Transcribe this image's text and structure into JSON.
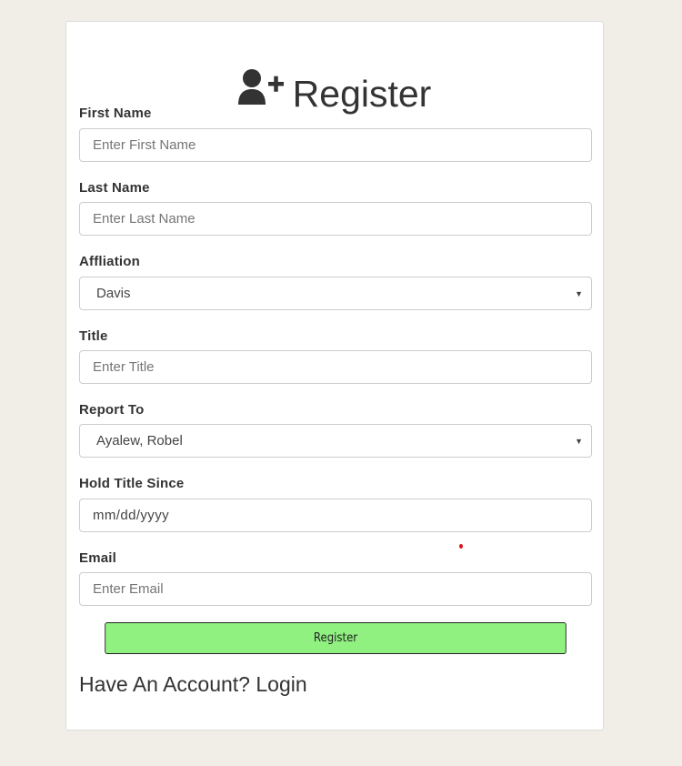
{
  "form": {
    "title": "Register",
    "icon": "user-plus-icon",
    "fields": {
      "first_name": {
        "label": "First Name",
        "placeholder": "Enter First Name"
      },
      "last_name": {
        "label": "Last Name",
        "placeholder": "Enter Last Name"
      },
      "affiliation": {
        "label": "Affliation",
        "value": "Davis"
      },
      "title": {
        "label": "Title",
        "placeholder": "Enter Title"
      },
      "report_to": {
        "label": "Report To",
        "value": "Ayalew, Robel"
      },
      "hold_title_since": {
        "label": "Hold Title Since",
        "value": "mm/dd/yyyy"
      },
      "email": {
        "label": "Email",
        "placeholder": "Enter Email"
      }
    },
    "submit_label": "Register",
    "footer": {
      "prompt": "Have An Account?",
      "login_link": "Login"
    }
  },
  "colors": {
    "page_background": "#f1eee8",
    "button_background": "#90f080"
  }
}
